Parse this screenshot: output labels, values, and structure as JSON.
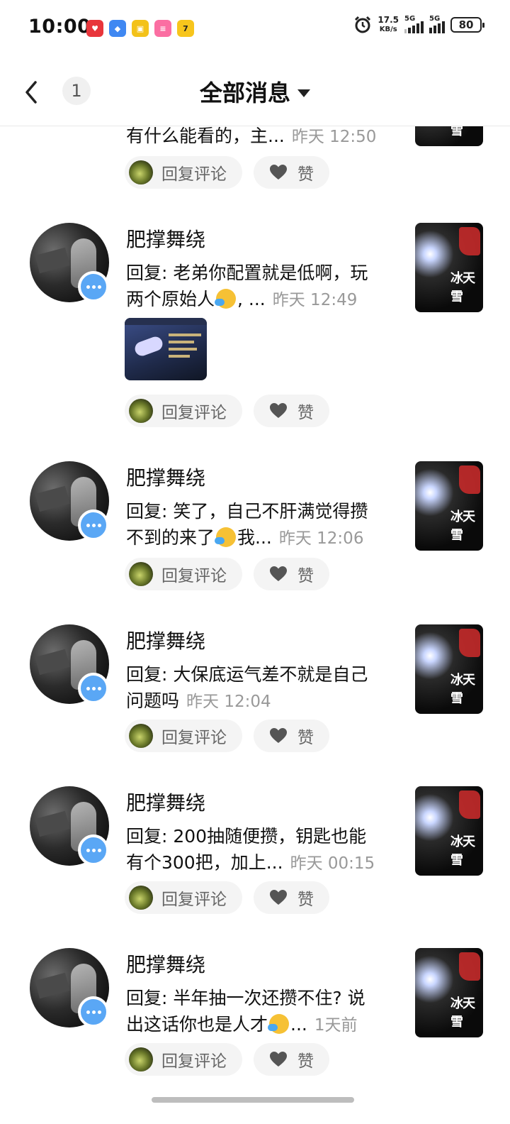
{
  "status_bar": {
    "time": "10:00",
    "app_icons": [
      "app-red-icon",
      "app-blue-icon",
      "app-yellow-icon",
      "bilibili-icon",
      "app-seven-icon"
    ],
    "net_speed_value": "17.5",
    "net_speed_unit": "KB/s",
    "signal_1": "5G",
    "signal_2": "5G",
    "battery": "80"
  },
  "navbar": {
    "back_icon": "back-arrow-icon",
    "unread_count": "1",
    "title": "全部消息"
  },
  "actions": {
    "reply_label": "回复评论",
    "like_label": "赞"
  },
  "messages": [
    {
      "name": "",
      "text": "有什么能看的，主...",
      "time": "昨天 12:50",
      "has_image": false
    },
    {
      "name": "肥撑舞绕",
      "text_line1": "回复: 老弟你配置就是低啊，玩",
      "text_line2": "两个原始人",
      "text_tail": ", ...",
      "time": "昨天 12:49",
      "has_image": true,
      "thumb_text": "冰天雪"
    },
    {
      "name": "肥撑舞绕",
      "text_line1": "回复: 笑了，自己不肝满觉得攒",
      "text_line2": "不到的来了",
      "text_tail": "我...",
      "time": "昨天 12:06",
      "thumb_text": "冰天雪"
    },
    {
      "name": "肥撑舞绕",
      "text_line1": "回复: 大保底运气差不就是自己",
      "text_line2": "问题吗",
      "text_tail": "",
      "time": "昨天 12:04",
      "thumb_text": "冰天雪"
    },
    {
      "name": "肥撑舞绕",
      "text_line1": "回复: 200抽随便攒，钥匙也能",
      "text_line2": "有个300把，加上...",
      "text_tail": "",
      "time": "昨天 00:15",
      "thumb_text": "冰天雪"
    },
    {
      "name": "肥撑舞绕",
      "text_line1": "回复: 半年抽一次还攒不住? 说",
      "text_line2": "出这话你也是人才",
      "text_tail": "...",
      "time": "1天前",
      "thumb_text": "冰天雪"
    }
  ],
  "colors": {
    "accent_blue": "#5aa7f5",
    "pill_bg": "#f4f4f4",
    "muted_text": "#999999"
  }
}
